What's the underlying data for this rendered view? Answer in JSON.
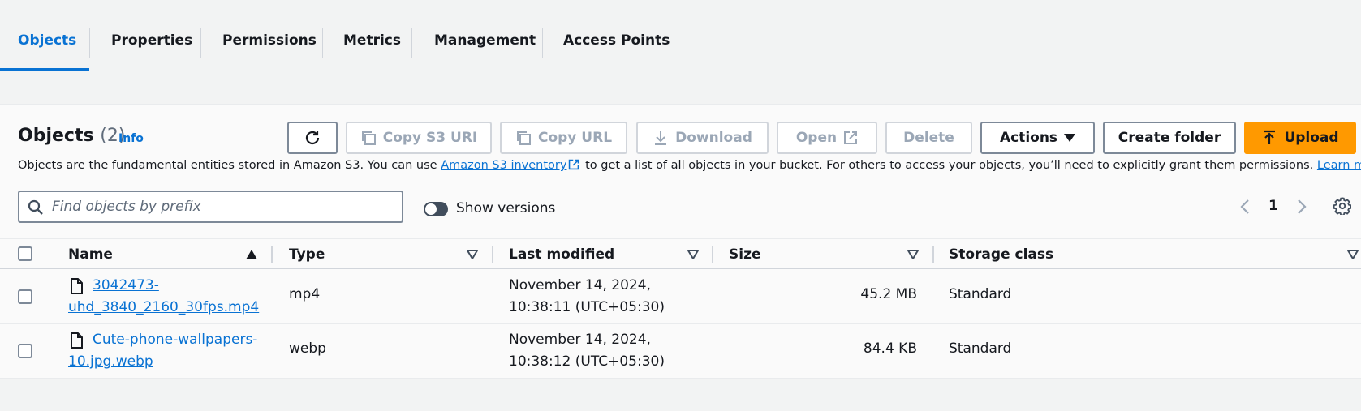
{
  "tabs": [
    {
      "label": "Objects",
      "active": true
    },
    {
      "label": "Properties",
      "active": false
    },
    {
      "label": "Permissions",
      "active": false
    },
    {
      "label": "Metrics",
      "active": false
    },
    {
      "label": "Management",
      "active": false
    },
    {
      "label": "Access Points",
      "active": false
    }
  ],
  "objects": {
    "title": "Objects",
    "count": "(2)",
    "info_label": "Info",
    "description": {
      "before_link": "Objects are the fundamental entities stored in Amazon S3. You can use ",
      "inventory_link": "Amazon S3 inventory",
      "middle": " to get a list of all objects in your bucket. For others to access your objects, you’ll need to explicitly grant them permissions. ",
      "learn_more": "Learn more"
    },
    "toolbar": {
      "refresh_icon": "refresh-icon",
      "copy_s3_uri": "Copy S3 URI",
      "copy_url": "Copy URL",
      "download": "Download",
      "open": "Open",
      "delete": "Delete",
      "actions": "Actions",
      "create_folder": "Create folder",
      "upload": "Upload"
    },
    "search": {
      "placeholder": "Find objects by prefix",
      "value": ""
    },
    "show_versions": {
      "label": "Show versions",
      "enabled": false
    },
    "pagination": {
      "current_page": "1"
    },
    "columns": [
      "Name",
      "Type",
      "Last modified",
      "Size",
      "Storage class"
    ],
    "rows": [
      {
        "name_line1": "3042473-",
        "name_line2": "uhd_3840_2160_30fps.mp4",
        "type": "mp4",
        "modified_line1": "November 14, 2024,",
        "modified_line2": "10:38:11 (UTC+05:30)",
        "size": "45.2 MB",
        "storage_class": "Standard"
      },
      {
        "name_line1": "Cute-phone-wallpapers-",
        "name_line2": "10.jpg.webp",
        "type": "webp",
        "modified_line1": "November 14, 2024,",
        "modified_line2": "10:38:12 (UTC+05:30)",
        "size": "84.4 KB",
        "storage_class": "Standard"
      }
    ]
  },
  "colors": {
    "accent": "#0972d3",
    "upload": "#ff9900",
    "text": "#16191f"
  }
}
